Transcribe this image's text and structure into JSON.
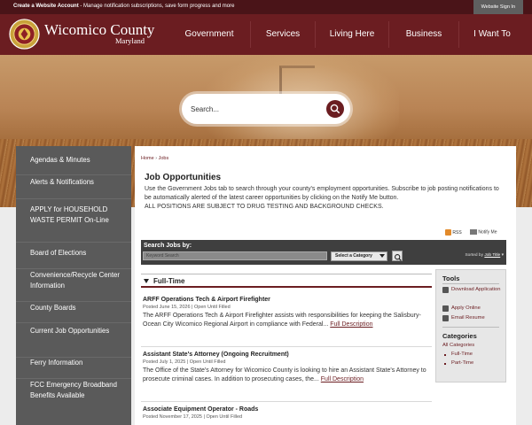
{
  "topbar": {
    "create_bold": "Create a Website Account",
    "create_rest": " - Manage notification subscriptions, save form progress and more",
    "signin": "Website Sign In"
  },
  "brand": {
    "name": "Wicomico County",
    "state": "Maryland",
    "seal_icon": "county-seal-logo"
  },
  "nav": [
    "Government",
    "Services",
    "Living Here",
    "Business",
    "I Want To"
  ],
  "hero_search": {
    "placeholder": "Search...",
    "icon": "search-icon"
  },
  "sidebar": [
    "Agendas & Minutes",
    "Alerts & Notifications",
    "APPLY for HOUSEHOLD WASTE PERMIT On-Line",
    "Board of Elections",
    "Convenience/Recycle Center Information",
    "County Boards",
    "Current Job Opportunities",
    "Ferry Information",
    "FCC Emergency Broadband Benefits Available"
  ],
  "breadcrumb": {
    "home": "Home",
    "sep": "›",
    "current": "Jobs"
  },
  "page": {
    "title": "Job Opportunities",
    "intro": "Use the Government Jobs tab to search through your county's employment opportunities. Subscribe to job posting notifications to be automatically alerted of the latest career opportunities by clicking on the Notify Me button.",
    "notice": "ALL POSITIONS ARE SUBJECT TO DRUG TESTING AND BACKGROUND CHECKS."
  },
  "actions": {
    "rss": "RSS",
    "notify": "Notify Me"
  },
  "search_jobs": {
    "label": "Search Jobs by:",
    "keyword_placeholder": "Keyword Search",
    "category": "Select a Category",
    "sorted_by": "Sorted by",
    "sort_field": "Job Title"
  },
  "section": "Full-Time",
  "jobs": [
    {
      "title": "ARFF Operations Tech & Airport Firefighter",
      "meta": "Posted June 15, 2026 | Open Until Filled",
      "desc": "The ARFF Operations Tech & Airport Firefighter assists with responsibilities for keeping the Salisbury-Ocean City Wicomico Regional Airport in compliance with Federal...",
      "more": "Full Description"
    },
    {
      "title": "Assistant State's Attorney (Ongoing Recruitment)",
      "meta": "Posted July 1, 2025 | Open Until Filled",
      "desc": "The Office of the State's Attorney for Wicomico County is looking to hire an Assistant State's Attorney to prosecute criminal cases. In addition to prosecuting cases, the...",
      "more": "Full Description"
    },
    {
      "title": "Associate Equipment Operator - Roads",
      "meta": "Posted November 17, 2025 | Open Until Filled",
      "desc": "",
      "more": ""
    }
  ],
  "tools": {
    "heading": "Tools",
    "links": [
      "Download Application",
      "Apply Online",
      "Email Resume"
    ],
    "categories_heading": "Categories",
    "all_categories": "All Categories",
    "categories": [
      "Full-Time",
      "Part-Time"
    ]
  },
  "colors": {
    "brand_maroon": "#6b1d21",
    "topbar": "#4a1418",
    "sidebar": "#5a5a5a"
  }
}
